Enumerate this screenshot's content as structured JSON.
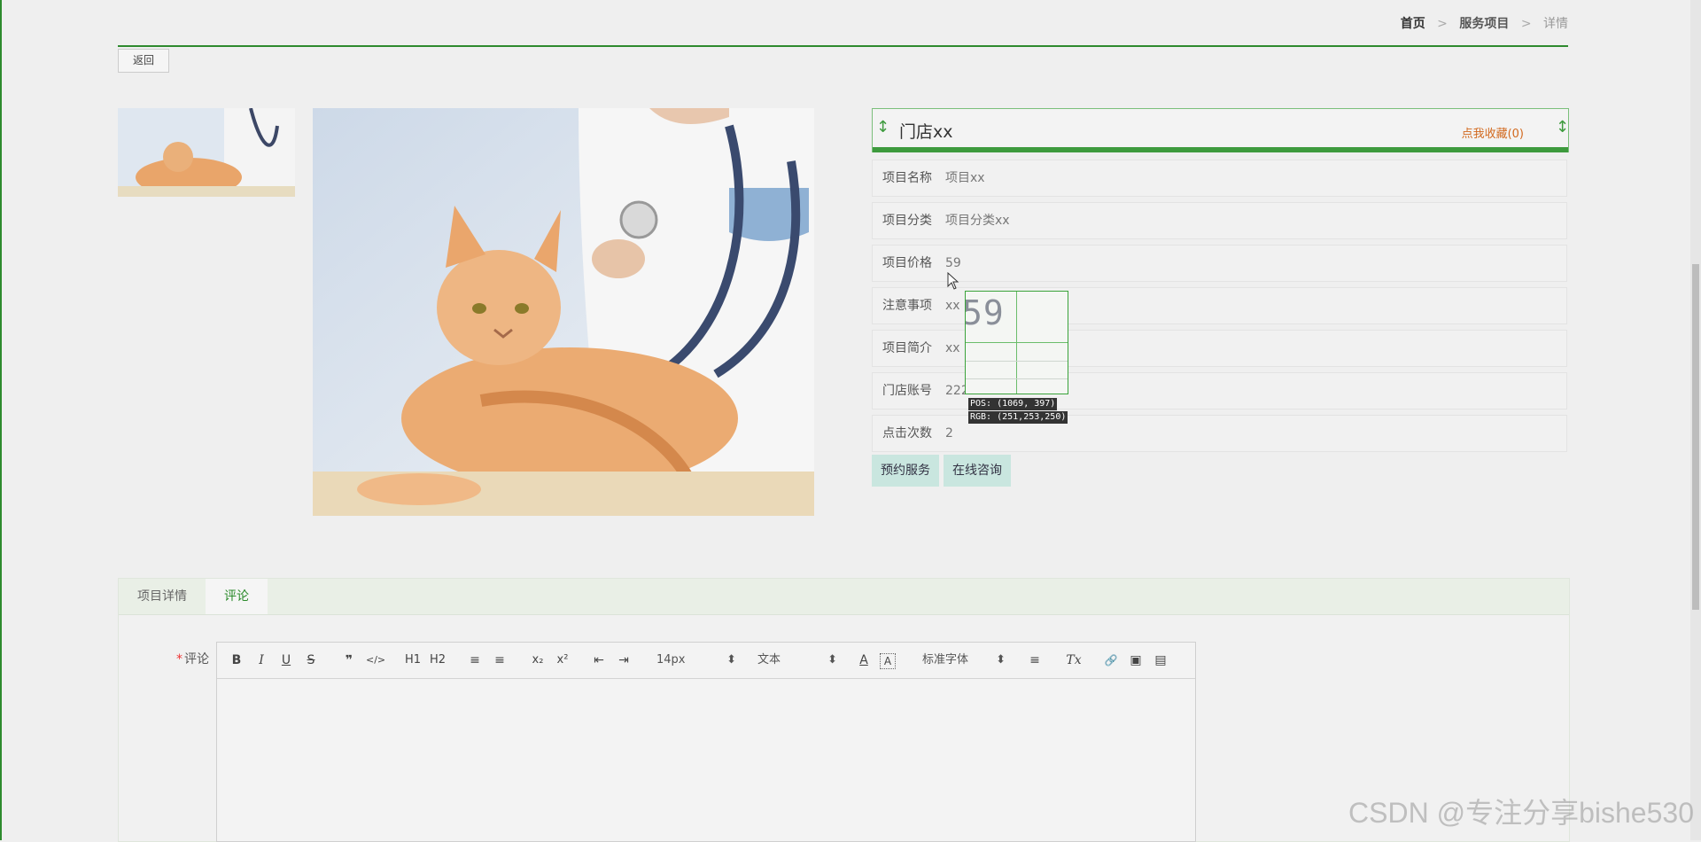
{
  "breadcrumb": {
    "home": "首页",
    "sep1": ">",
    "section": "服务项目",
    "sep2": ">",
    "current": "详情"
  },
  "back_label": "返回",
  "shop": {
    "name": "门店xx",
    "favorite_label": "点我收藏(0)"
  },
  "details": [
    {
      "label": "项目名称",
      "value": "项目xx"
    },
    {
      "label": "项目分类",
      "value": "项目分类xx"
    },
    {
      "label": "项目价格",
      "value": "59"
    },
    {
      "label": "注意事项",
      "value": "xx"
    },
    {
      "label": "项目简介",
      "value": "xx"
    },
    {
      "label": "门店账号",
      "value": "222"
    },
    {
      "label": "点击次数",
      "value": "2"
    }
  ],
  "actions": {
    "book": "预约服务",
    "consult": "在线咨询"
  },
  "tabs": [
    {
      "label": "项目详情",
      "active": false
    },
    {
      "label": "评论",
      "active": true
    }
  ],
  "comment": {
    "required_mark": "*",
    "label": "评论"
  },
  "toolbar": {
    "bold": "B",
    "italic": "I",
    "underline": "U",
    "strike": "S",
    "quote": "❞",
    "code": "</>",
    "h1": "H1",
    "h2": "H2",
    "ol": "≡",
    "ul": "≡",
    "sub": "x₂",
    "sup": "x²",
    "outdent": "⇤",
    "indent": "⇥",
    "size": "14px",
    "header": "文本",
    "font": "标准字体",
    "color": "A",
    "background": "A",
    "align": "≡",
    "clean": "Tx",
    "link": "🔗",
    "image": "▣",
    "video": "▤"
  },
  "picker": {
    "magnified_text": "59",
    "pos": "POS: (1069, 397)",
    "rgb": "RGB: (251,253,250)"
  },
  "watermark": "CSDN @专注分享bishe530",
  "colors": {
    "accent": "#2f8a2f",
    "favorite": "#d2691e",
    "button_bg": "#c9e6df"
  },
  "icons": [
    "cursor-arrow-icon"
  ]
}
